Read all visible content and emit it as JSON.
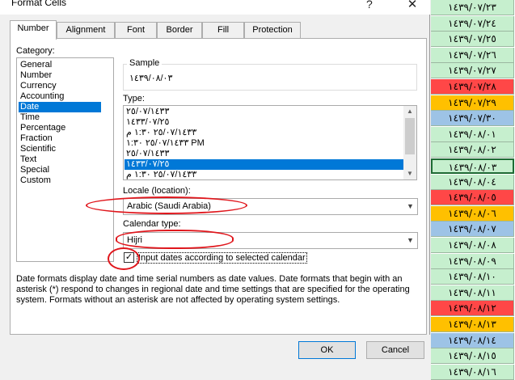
{
  "window": {
    "title": "Format Cells",
    "help": "?",
    "close": "✕"
  },
  "tabs": [
    "Number",
    "Alignment",
    "Font",
    "Border",
    "Fill",
    "Protection"
  ],
  "category": {
    "label": "Category:",
    "items": [
      "General",
      "Number",
      "Currency",
      "Accounting",
      "Date",
      "Time",
      "Percentage",
      "Fraction",
      "Scientific",
      "Text",
      "Special",
      "Custom"
    ],
    "selected": "Date"
  },
  "sample": {
    "label": "Sample",
    "value": "١٤٣٩/٠٨/٠٣"
  },
  "type": {
    "label": "Type:",
    "items": [
      "٢٥/٠٧/١٤٣٣",
      "١٤٣٣/٠٧/٢٥",
      "٢٥/٠٧/١٤٣٣ ١:٣٠ م",
      "٢٥/٠٧/١٤٣٣ ١:٣٠ PM",
      "٢٥/٠٧/١٤٣٣",
      "١٤٣٣/٠٧/٢٥",
      "٢٥/٠٧/١٤٣٣ ١:٣٠ م"
    ],
    "selected_index": 5
  },
  "locale": {
    "label": "Locale (location):",
    "value": "Arabic (Saudi Arabia)"
  },
  "calendar": {
    "label": "Calendar type:",
    "value": "Hijri"
  },
  "input_dates": {
    "label": "Input dates according to selected calendar",
    "checked": true,
    "mark": "✓"
  },
  "description": "Date formats display date and time serial numbers as date values.  Date formats that begin with an asterisk (*) respond to changes in regional date and time settings that are specified for the operating system. Formats without an asterisk are not affected by operating system settings.",
  "buttons": {
    "ok": "OK",
    "cancel": "Cancel"
  },
  "sheet": {
    "cells": [
      {
        "text": "١٤٣٩/٠٧/٢٣",
        "color": "#c6efce"
      },
      {
        "text": "١٤٣٩/٠٧/٢٤",
        "color": "#c6efce"
      },
      {
        "text": "١٤٣٩/٠٧/٢٥",
        "color": "#c6efce"
      },
      {
        "text": "١٤٣٩/٠٧/٢٦",
        "color": "#c6efce"
      },
      {
        "text": "١٤٣٩/٠٧/٢٧",
        "color": "#c6efce"
      },
      {
        "text": "١٤٣٩/٠٧/٢٨",
        "color": "#ff4747"
      },
      {
        "text": "١٤٣٩/٠٧/٢٩",
        "color": "#ffc000"
      },
      {
        "text": "١٤٣٩/٠٧/٣٠",
        "color": "#9dc3e6"
      },
      {
        "text": "١٤٣٩/٠٨/٠١",
        "color": "#c6efce"
      },
      {
        "text": "١٤٣٩/٠٨/٠٢",
        "color": "#c6efce"
      },
      {
        "text": "١٤٣٩/٠٨/٠٣",
        "color": "#c6efce"
      },
      {
        "text": "١٤٣٩/٠٨/٠٤",
        "color": "#c6efce"
      },
      {
        "text": "١٤٣٩/٠٨/٠٥",
        "color": "#ff4747"
      },
      {
        "text": "١٤٣٩/٠٨/٠٦",
        "color": "#ffc000"
      },
      {
        "text": "١٤٣٩/٠٨/٠٧",
        "color": "#9dc3e6"
      },
      {
        "text": "١٤٣٩/٠٨/٠٨",
        "color": "#c6efce"
      },
      {
        "text": "١٤٣٩/٠٨/٠٩",
        "color": "#c6efce"
      },
      {
        "text": "١٤٣٩/٠٨/١٠",
        "color": "#c6efce"
      },
      {
        "text": "١٤٣٩/٠٨/١١",
        "color": "#c6efce"
      },
      {
        "text": "١٤٣٩/٠٨/١٢",
        "color": "#ff4747"
      },
      {
        "text": "١٤٣٩/٠٨/١٣",
        "color": "#ffc000"
      },
      {
        "text": "١٤٣٩/٠٨/١٤",
        "color": "#9dc3e6"
      },
      {
        "text": "١٤٣٩/٠٨/١٥",
        "color": "#c6efce"
      },
      {
        "text": "١٤٣٩/٠٨/١٦",
        "color": "#c6efce"
      }
    ],
    "active_index": 10
  }
}
